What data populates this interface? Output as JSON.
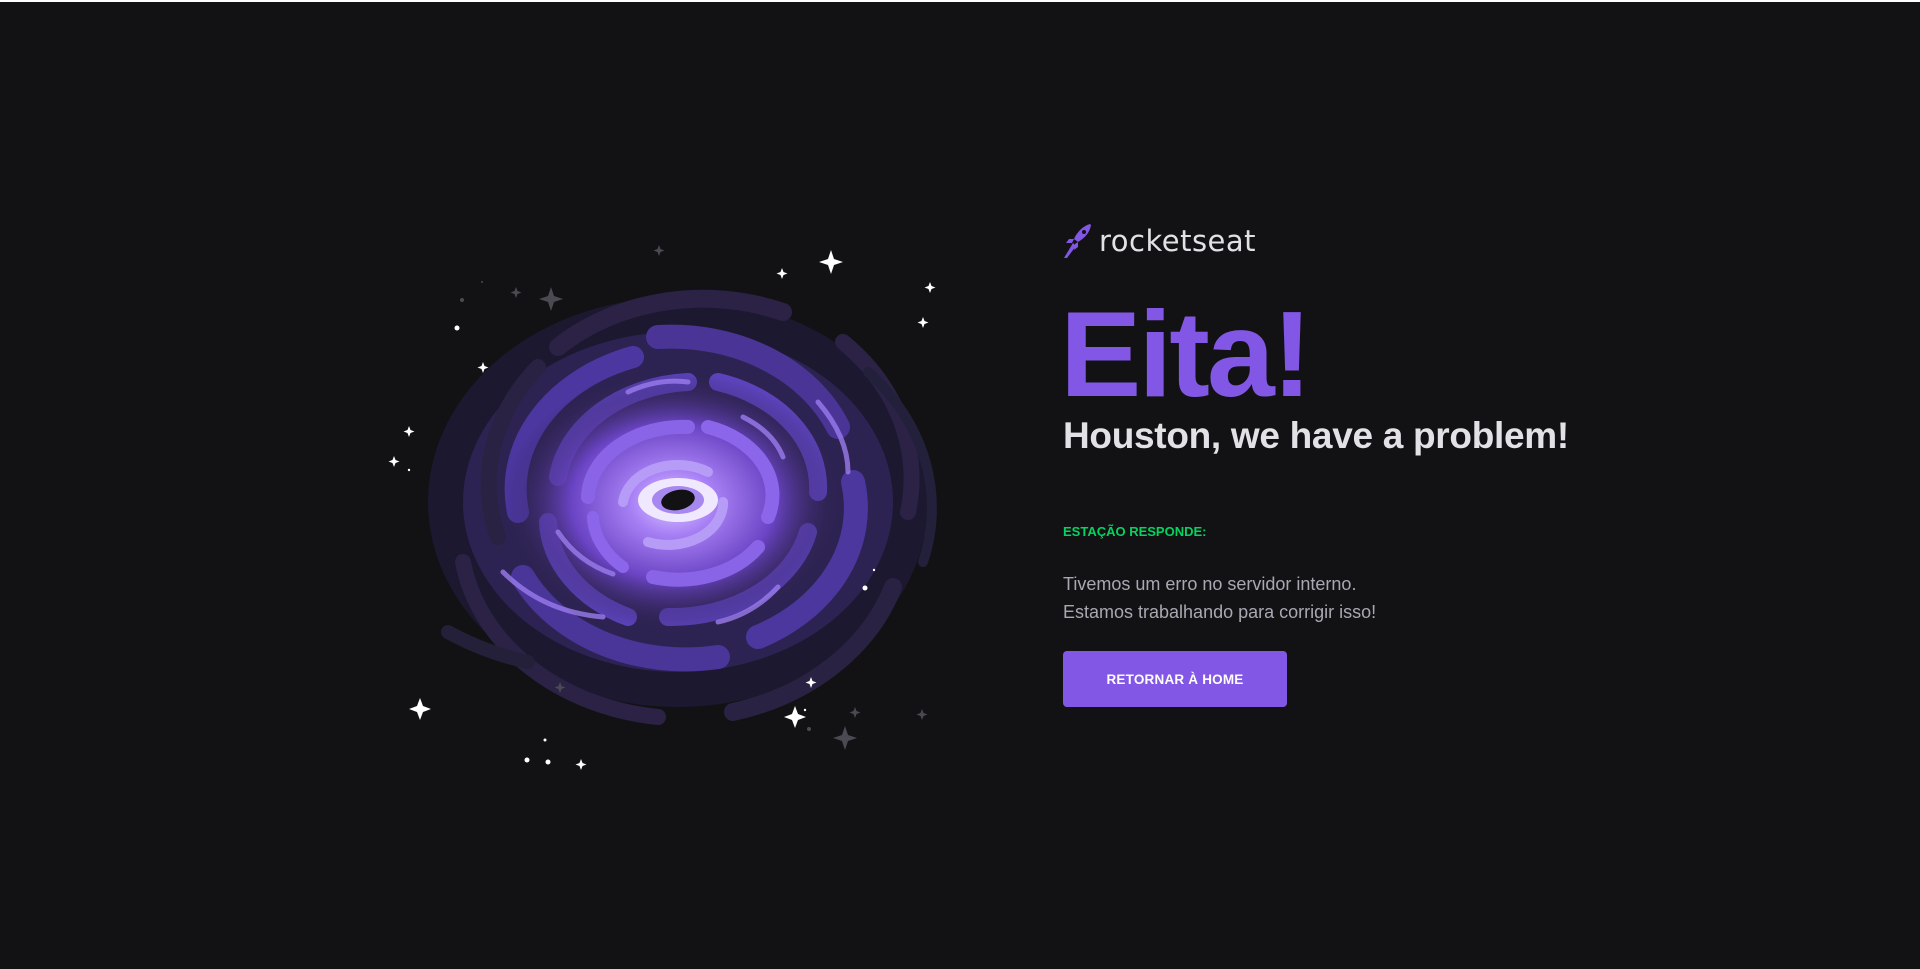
{
  "brand": {
    "name": "rocketseat",
    "logo_icon": "rocket-icon",
    "accent_color": "#8257e5"
  },
  "illustration": {
    "icon": "black-hole-galaxy-icon"
  },
  "error": {
    "headline": "Eita!",
    "subheadline": "Houston, we have a problem!",
    "station_label": "ESTAÇÃO RESPONDE:",
    "message_line_1": "Tivemos um erro no servidor interno.",
    "message_line_2": "Estamos trabalhando para corrigir isso!"
  },
  "actions": {
    "home_button_label": "RETORNAR À HOME"
  },
  "colors": {
    "background": "#121214",
    "primary": "#8257e5",
    "success": "#04d361",
    "text_light": "#e1e1e6",
    "text_muted": "#a8a8b3"
  }
}
